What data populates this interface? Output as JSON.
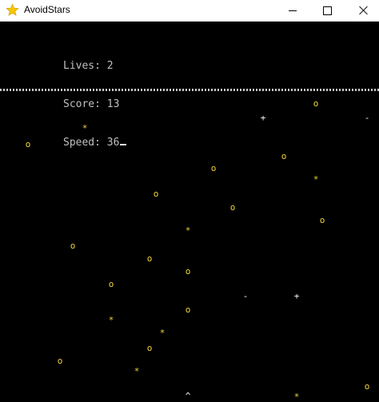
{
  "window": {
    "title": "AvoidStars",
    "icon": "star-icon",
    "colors": {
      "titlebar": "#ffffff",
      "background": "#000000",
      "accent": "#f2d33a"
    }
  },
  "hud": {
    "lives_label": "Lives: ",
    "lives": "2",
    "score_label": "Score: ",
    "score": "13",
    "speed_label": "Speed: ",
    "speed": "36"
  },
  "objects": [
    {
      "glyph": "o",
      "kind": "o"
    },
    {
      "glyph": "+",
      "kind": "plus"
    },
    {
      "glyph": "-",
      "kind": "minus"
    },
    {
      "glyph": "*",
      "kind": "star"
    },
    {
      "glyph": "o",
      "kind": "o"
    },
    {
      "glyph": "o",
      "kind": "o"
    },
    {
      "glyph": "o",
      "kind": "o"
    },
    {
      "glyph": "*",
      "kind": "star"
    },
    {
      "glyph": "o",
      "kind": "o"
    },
    {
      "glyph": "o",
      "kind": "o"
    },
    {
      "glyph": "o",
      "kind": "o"
    },
    {
      "glyph": "*",
      "kind": "star"
    },
    {
      "glyph": "o",
      "kind": "o"
    },
    {
      "glyph": "o",
      "kind": "o"
    },
    {
      "glyph": "o",
      "kind": "o"
    },
    {
      "glyph": "o",
      "kind": "o"
    },
    {
      "glyph": "-",
      "kind": "minus"
    },
    {
      "glyph": "+",
      "kind": "plus"
    },
    {
      "glyph": "o",
      "kind": "o"
    },
    {
      "glyph": "*",
      "kind": "star"
    },
    {
      "glyph": "*",
      "kind": "star"
    },
    {
      "glyph": "o",
      "kind": "o"
    },
    {
      "glyph": "o",
      "kind": "o"
    },
    {
      "glyph": "*",
      "kind": "star"
    },
    {
      "glyph": "o",
      "kind": "o"
    },
    {
      "glyph": "*",
      "kind": "star"
    }
  ],
  "player": {
    "glyph": "^"
  }
}
